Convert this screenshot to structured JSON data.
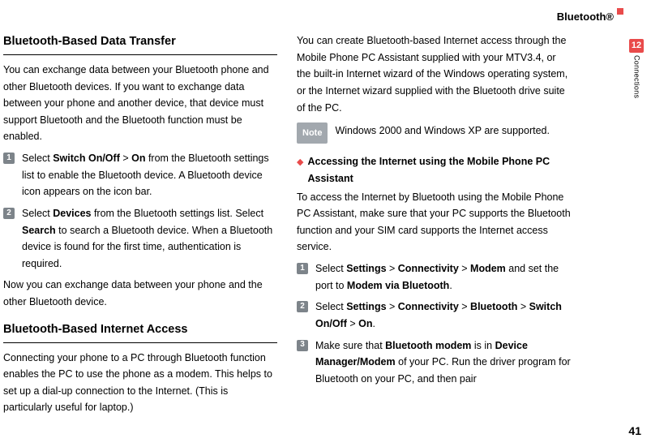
{
  "header": {
    "title": "Bluetooth®"
  },
  "sidebar": {
    "chapter": "12",
    "label": "Connections"
  },
  "pageNumber": "41",
  "left": {
    "h1": "Bluetooth-Based Data Transfer",
    "intro": "You can exchange data between your Bluetooth phone and other Bluetooth devices. If you want to exchange data between your phone and another device, that device must support Bluetooth and the Bluetooth function must be enabled.",
    "steps": [
      {
        "num": "1",
        "parts": [
          "Select ",
          "Switch On/Off",
          " > ",
          "On",
          " from the Bluetooth settings list to enable the Bluetooth device. A Bluetooth device icon appears on the icon bar."
        ]
      },
      {
        "num": "2",
        "parts": [
          "Select ",
          "Devices",
          " from the Bluetooth settings list. Select ",
          "Search",
          " to search a Bluetooth device. When a Bluetooth device is found for the first time, authentication is required."
        ]
      }
    ],
    "after": "Now you can exchange data between your phone and the other Bluetooth device.",
    "h2": "Bluetooth-Based Internet Access",
    "p2": "Connecting your phone to a PC through Bluetooth function enables the PC to use the phone as a modem. This helps to set up a dial-up connection to the Internet. (This is particularly useful for laptop.)"
  },
  "right": {
    "p1": "You can create Bluetooth-based Internet access through the Mobile Phone PC Assistant supplied with your MTV3.4, or the built-in Internet wizard of the Windows operating system, or the Internet wizard supplied with the Bluetooth drive suite of the PC.",
    "noteLabel": "Note",
    "noteText": "Windows 2000 and Windows XP are supported.",
    "subhead": "Accessing the Internet using the Mobile Phone PC Assistant",
    "p2": "To access the Internet by Bluetooth using the Mobile Phone PC Assistant, make sure that your PC supports the Bluetooth function and your SIM card supports the Internet access service.",
    "steps": [
      {
        "num": "1",
        "parts": [
          "Select ",
          "Settings",
          " > ",
          "Connectivity",
          " > ",
          "Modem",
          " and set the port to ",
          "Modem via Bluetooth",
          "."
        ]
      },
      {
        "num": "2",
        "parts": [
          "Select ",
          "Settings",
          " > ",
          "Connectivity",
          " > ",
          "Bluetooth",
          " > ",
          "Switch On/Off",
          " > ",
          "On",
          "."
        ]
      },
      {
        "num": "3",
        "parts": [
          "Make sure that ",
          "Bluetooth modem",
          " is in ",
          "Device Manager/Modem",
          " of your PC. Run the driver program for Bluetooth on your PC, and then pair"
        ]
      }
    ]
  }
}
